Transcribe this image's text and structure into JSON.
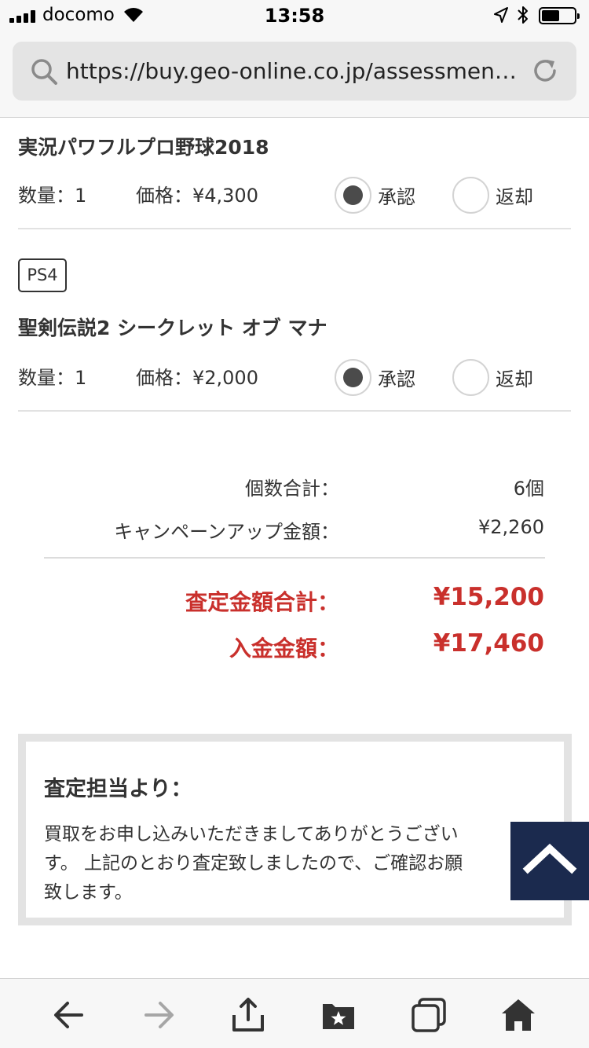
{
  "status_bar": {
    "carrier": "docomo",
    "time": "13:58",
    "icons": [
      "signal-icon",
      "wifi-icon",
      "location-icon",
      "bluetooth-icon",
      "battery-icon"
    ]
  },
  "browser": {
    "url": "https://buy.geo-online.co.jp/assessment..."
  },
  "products": [
    {
      "title": "実況パワフルプロ野球2018",
      "quantity": "数量：1",
      "price": "価格：¥4,300",
      "approve_label": "承認",
      "return_label": "返却",
      "selected": "approve"
    },
    {
      "platform": "PS4",
      "title": "聖剣伝説2 シークレット オブ マナ",
      "quantity": "数量：1",
      "price": "価格：¥2,000",
      "approve_label": "承認",
      "return_label": "返却",
      "selected": "approve"
    }
  ],
  "totals": {
    "count_label": "個数合計：",
    "count_value": "6個",
    "campaign_label": "キャンペーンアップ金額：",
    "campaign_value": "¥2,260",
    "assessment_label": "査定金額合計：",
    "assessment_value": "¥15,200",
    "deposit_label": "入金金額：",
    "deposit_value": "¥17,460"
  },
  "message": {
    "title": "査定担当より：",
    "lines": [
      "買取をお申し込みいただきましてありがとうござい",
      "す。 上記のとおり査定致しましたので、ご確認お願",
      "致します。"
    ]
  },
  "colors": {
    "accent_red": "#c9302c",
    "scroll_top_bg": "#1b2a4e",
    "radio_checked": "#4b4b4b"
  }
}
